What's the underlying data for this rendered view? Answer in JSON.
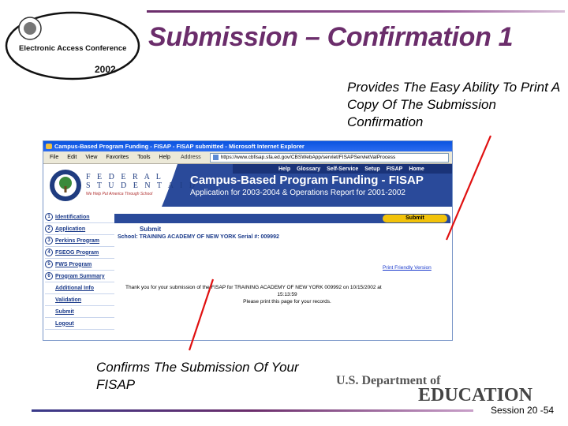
{
  "slide": {
    "title": "Submission – Confirmation 1",
    "callout_right": "Provides The Easy Ability To Print A Copy Of The Submission Confirmation",
    "callout_left": "Confirms The Submission Of Your FISAP",
    "session": "Session 20 -54",
    "conference_logo": {
      "name": "Electronic Access Conference",
      "year": "2002"
    },
    "doe_logo": {
      "top": "U.S. Department of",
      "bottom": "EDUCATION"
    }
  },
  "browser": {
    "window_title": "Campus-Based Program Funding - FISAP - FISAP submitted - Microsoft Internet Explorer",
    "menu": [
      "File",
      "Edit",
      "View",
      "Favorites",
      "Tools",
      "Help"
    ],
    "address_label": "Address",
    "address": "https://www.cbfisap.sfa.ed.gov/CBSWebApp/servlet/FISAPServletValProcess"
  },
  "site": {
    "nav_links": [
      "Help",
      "Glossary",
      "Self-Service",
      "Setup",
      "FISAP",
      "Home"
    ],
    "fsa_line1": "F E D E R A L",
    "fsa_line2": "S T U D E N T  A I D",
    "fsa_tagline": "We Help Put America Through School",
    "app_title": "Campus-Based Program Funding - FISAP",
    "app_subtitle": "Application for 2003-2004 & Operations Report for 2001-2002",
    "left_nav": [
      {
        "num": "1",
        "label": "Identification"
      },
      {
        "num": "2",
        "label": "Application"
      },
      {
        "num": "3",
        "label": "Perkins Program"
      },
      {
        "num": "4",
        "label": "FSEOG Program"
      },
      {
        "num": "5",
        "label": "FWS Program"
      },
      {
        "num": "6",
        "label": "Program Summary"
      },
      {
        "num": "",
        "label": "Additional Info"
      },
      {
        "num": "",
        "label": "Validation"
      },
      {
        "num": "",
        "label": "Submit"
      },
      {
        "num": "",
        "label": "Logout"
      }
    ],
    "submit_button": "Submit",
    "section_heading": "Submit",
    "school_line": "School: TRAINING ACADEMY OF NEW YORK   Serial #: 009992",
    "print_link": "Print Friendly Version",
    "thanks_line1": "Thank you for your submission of the FISAP for TRAINING ACADEMY OF NEW YORK 009992 on 10/15/2002 at",
    "thanks_time": "15:13:59",
    "thanks_line2": "Please print this page for your records."
  },
  "colors": {
    "title_purple": "#6b2d6b",
    "banner_blue": "#2a4a9a",
    "submit_yellow": "#f2c20a",
    "callout_red": "#e01010"
  }
}
